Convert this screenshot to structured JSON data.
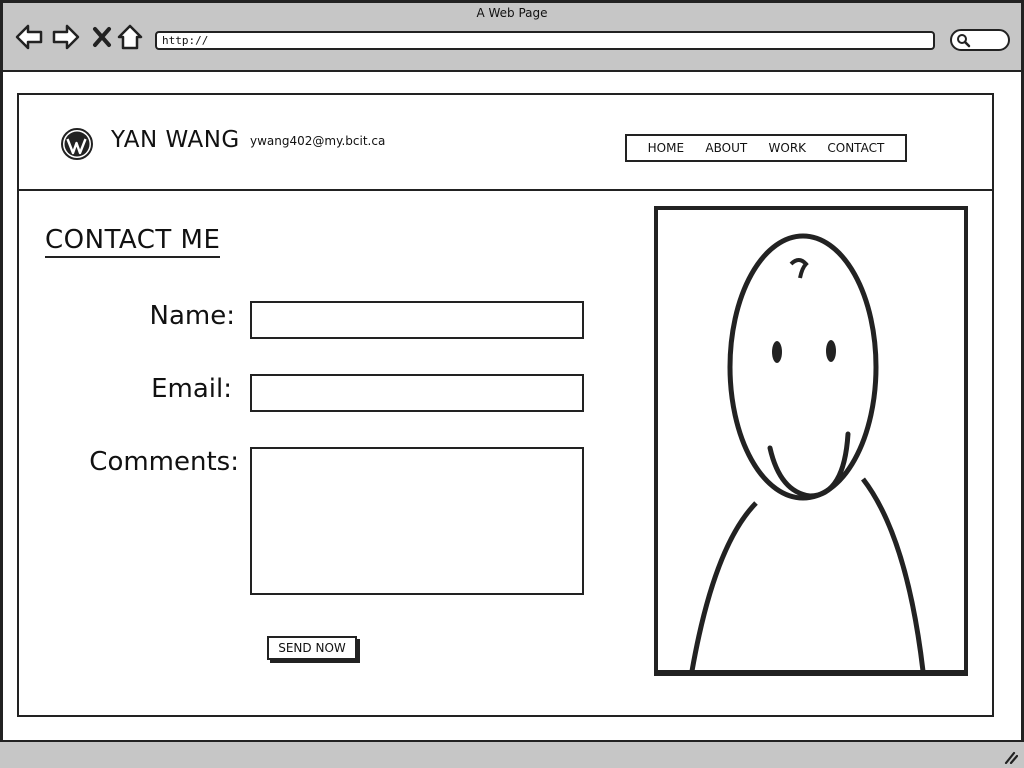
{
  "browser": {
    "title": "A Web Page",
    "url": "http://"
  },
  "header": {
    "logo_icon": "wordpress-icon",
    "site_name": "YAN WANG",
    "email": "ywang402@my.bcit.ca",
    "nav": [
      "HOME",
      "ABOUT",
      "WORK",
      "CONTACT"
    ]
  },
  "contact": {
    "title": "CONTACT ME",
    "name_label": "Name:",
    "email_label": "Email:",
    "comments_label": "Comments:",
    "name_value": "",
    "email_value": "",
    "comments_value": "",
    "send_label": "SEND NOW"
  },
  "photo": {
    "icon": "smiley-person-icon"
  }
}
